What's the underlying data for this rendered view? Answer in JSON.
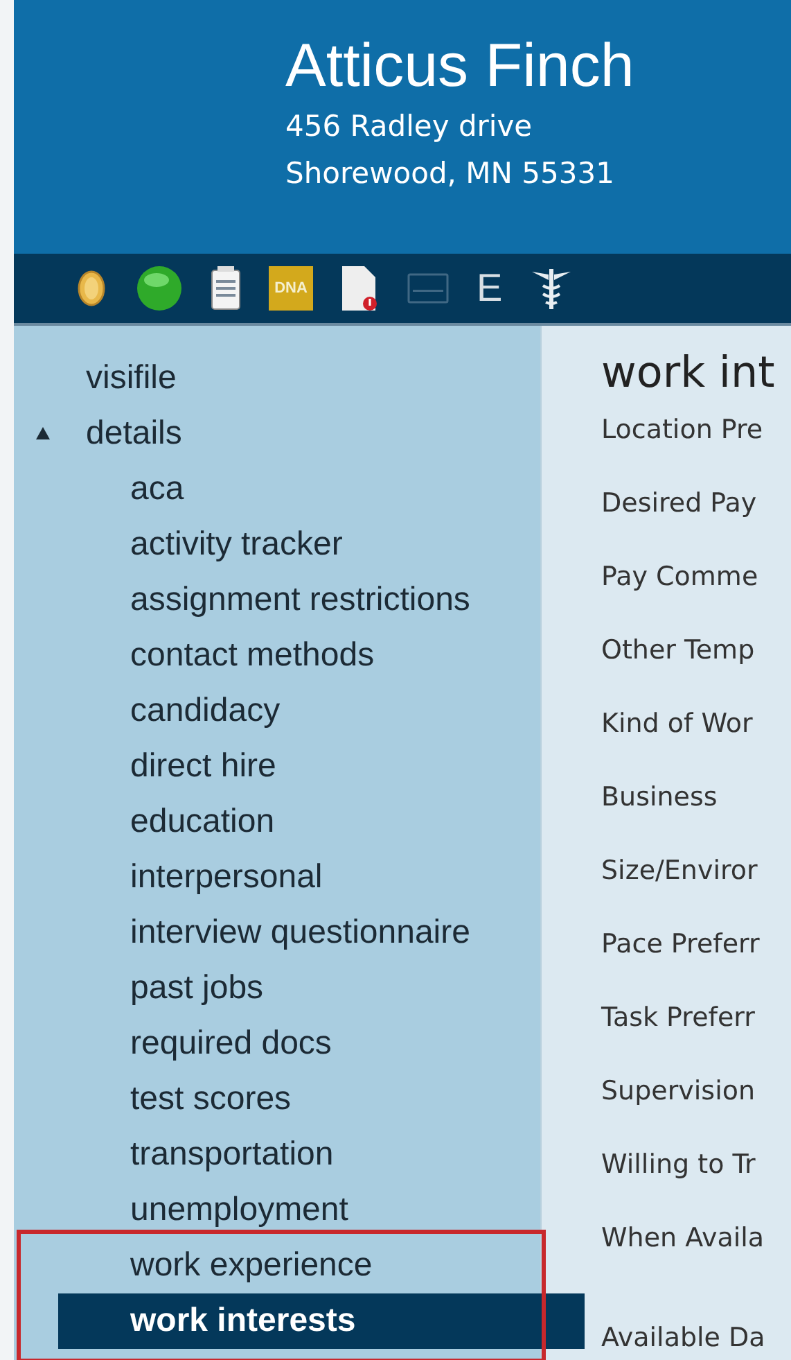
{
  "header": {
    "name": "Atticus Finch",
    "address_lines": [
      "456 Radley drive",
      "Shorewood, MN 55331"
    ]
  },
  "toolbar": [
    {
      "kind": "coin",
      "disabled": false
    },
    {
      "kind": "status",
      "disabled": false
    },
    {
      "kind": "notepad",
      "disabled": false
    },
    {
      "kind": "dna",
      "label": "DNA",
      "disabled": false
    },
    {
      "kind": "document",
      "disabled": false
    },
    {
      "kind": "card",
      "disabled": true
    },
    {
      "kind": "letter",
      "label": "E",
      "disabled": false
    },
    {
      "kind": "medical",
      "disabled": false
    }
  ],
  "sidebar": {
    "items": [
      {
        "label": "visifile",
        "selected": false
      },
      {
        "label": "details",
        "selected": false,
        "expanded": true,
        "children": [
          {
            "label": "aca",
            "selected": false
          },
          {
            "label": "activity tracker",
            "selected": false
          },
          {
            "label": "assignment restrictions",
            "selected": false
          },
          {
            "label": "contact methods",
            "selected": false
          },
          {
            "label": "candidacy",
            "selected": false
          },
          {
            "label": "direct hire",
            "selected": false
          },
          {
            "label": "education",
            "selected": false
          },
          {
            "label": "interpersonal",
            "selected": false
          },
          {
            "label": "interview questionnaire",
            "selected": false
          },
          {
            "label": "past jobs",
            "selected": false
          },
          {
            "label": "required docs",
            "selected": false
          },
          {
            "label": "test scores",
            "selected": false
          },
          {
            "label": "transportation",
            "selected": false
          },
          {
            "label": "unemployment",
            "selected": false
          },
          {
            "label": "work experience",
            "selected": false
          },
          {
            "label": "work interests",
            "selected": true
          }
        ]
      }
    ]
  },
  "content": {
    "title": "work int",
    "fields": [
      "Location Pre",
      "Desired Pay",
      "Pay Comme",
      "Other Temp",
      "Kind of Wor",
      "Business",
      "Size/Enviror",
      "Pace Preferr",
      "Task Preferr",
      "Supervision",
      "Willing to Tr",
      "When Availa",
      "Available Da"
    ]
  }
}
